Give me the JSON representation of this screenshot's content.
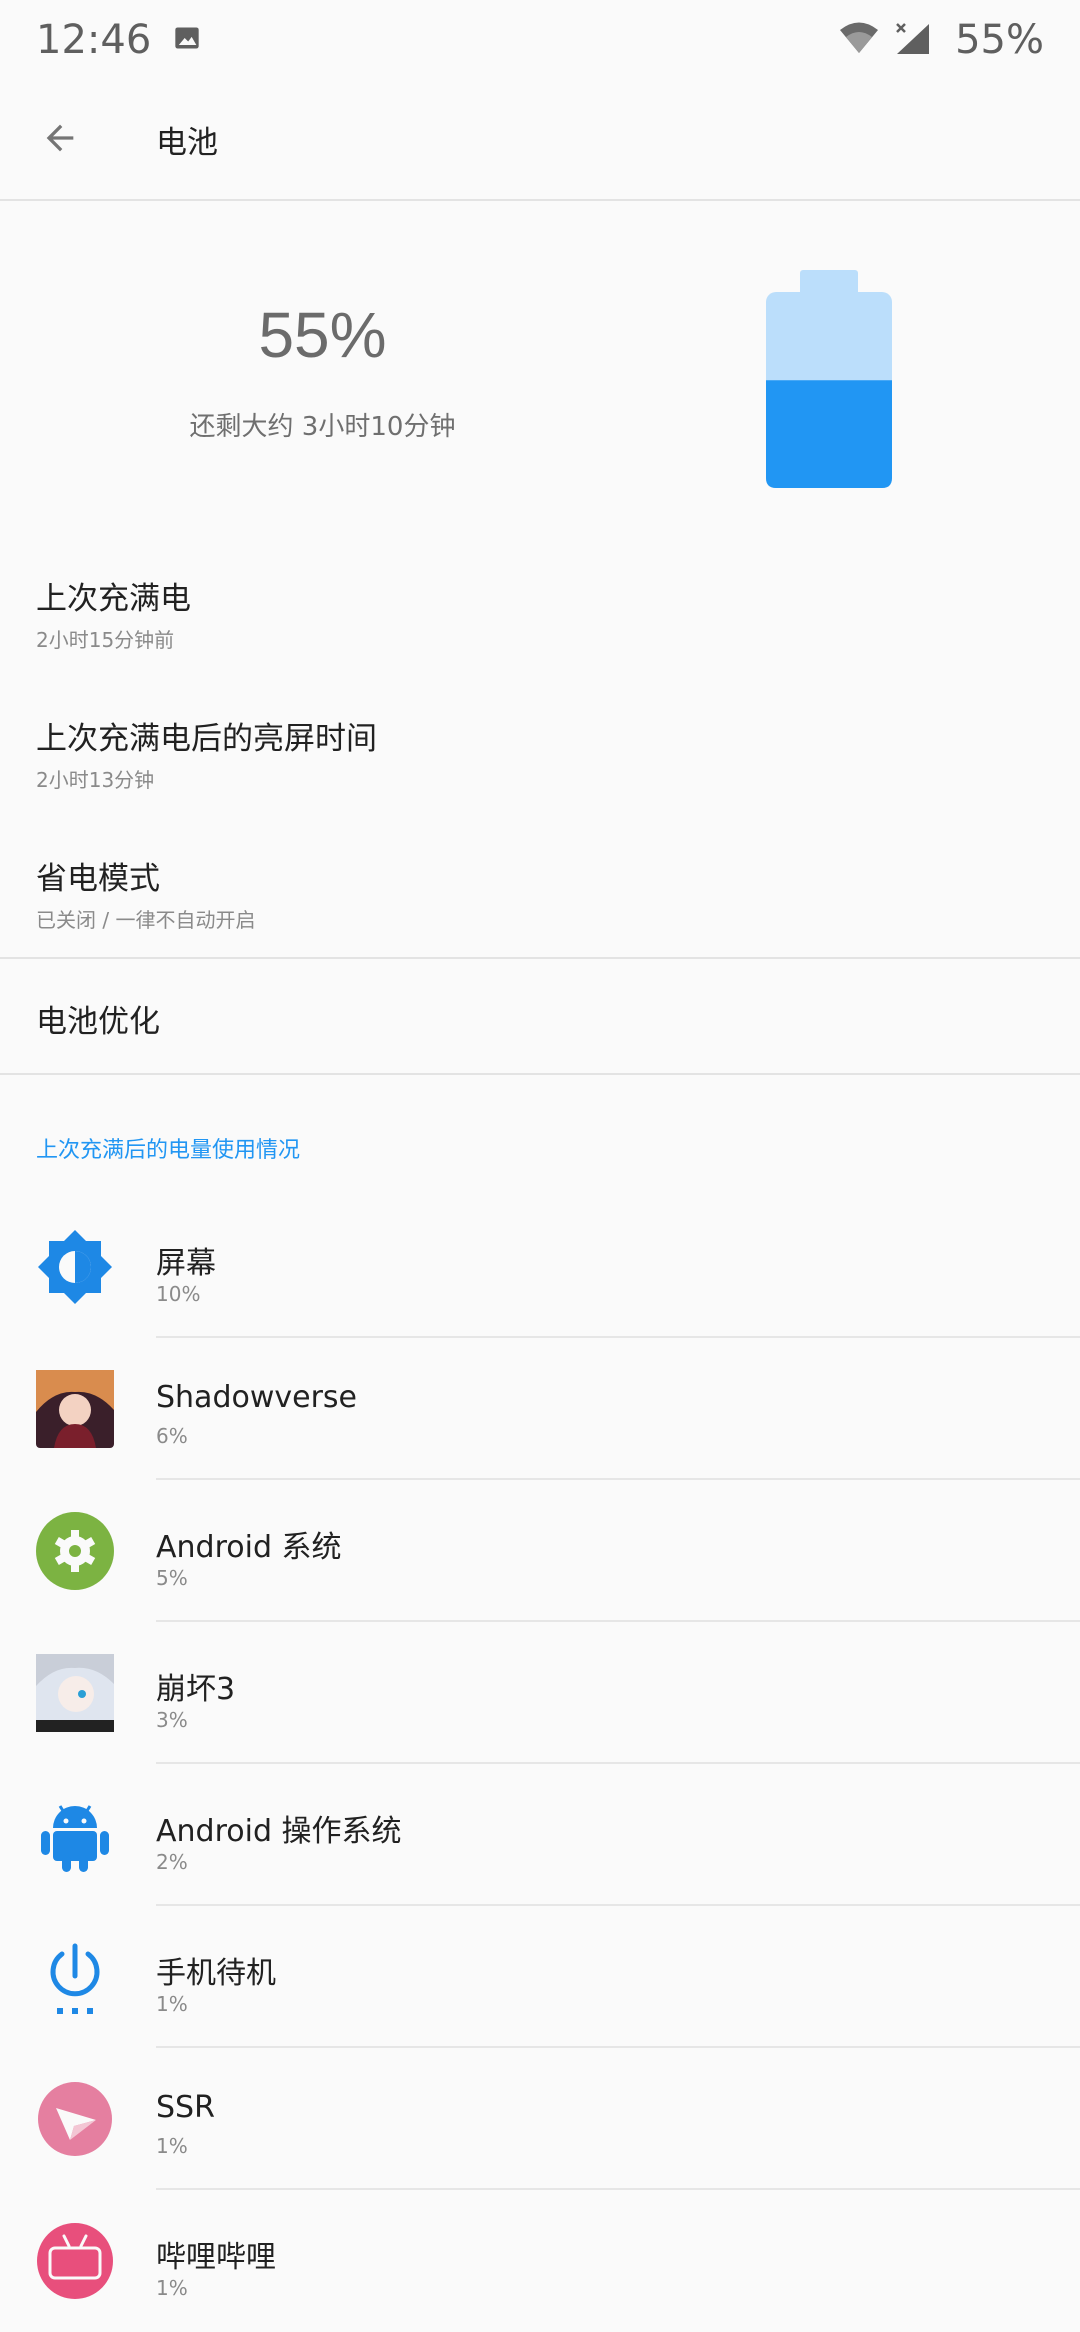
{
  "status_bar": {
    "time": "12:46",
    "battery": "55%"
  },
  "app_bar": {
    "title": "电池"
  },
  "battery": {
    "percent": "55%",
    "remaining": "还剩大约 3小时10分钟",
    "level_fraction": 0.55,
    "colors": {
      "fill": "#2196f3",
      "empty": "#bbdefb"
    }
  },
  "prefs": [
    {
      "title": "上次充满电",
      "subtitle": "2小时15分钟前"
    },
    {
      "title": "上次充满电后的亮屏时间",
      "subtitle": "2小时13分钟"
    },
    {
      "title": "省电模式",
      "subtitle": "已关闭 / 一律不自动开启"
    }
  ],
  "battery_optimization": {
    "title": "电池优化"
  },
  "usage_section": {
    "header": "上次充满后的电量使用情况",
    "accent": "#2196f3",
    "items": [
      {
        "name": "屏幕",
        "percent": "10%",
        "icon": "brightness-icon"
      },
      {
        "name": "Shadowverse",
        "percent": "6%",
        "icon": "shadowverse-app-icon"
      },
      {
        "name": "Android 系统",
        "percent": "5%",
        "icon": "settings-gear-icon"
      },
      {
        "name": "崩坏3",
        "percent": "3%",
        "icon": "honkai3-app-icon"
      },
      {
        "name": "Android 操作系统",
        "percent": "2%",
        "icon": "android-robot-icon"
      },
      {
        "name": "手机待机",
        "percent": "1%",
        "icon": "standby-power-icon"
      },
      {
        "name": "SSR",
        "percent": "1%",
        "icon": "ssr-paper-plane-icon"
      },
      {
        "name": "哔哩哔哩",
        "percent": "1%",
        "icon": "bilibili-app-icon"
      }
    ]
  }
}
